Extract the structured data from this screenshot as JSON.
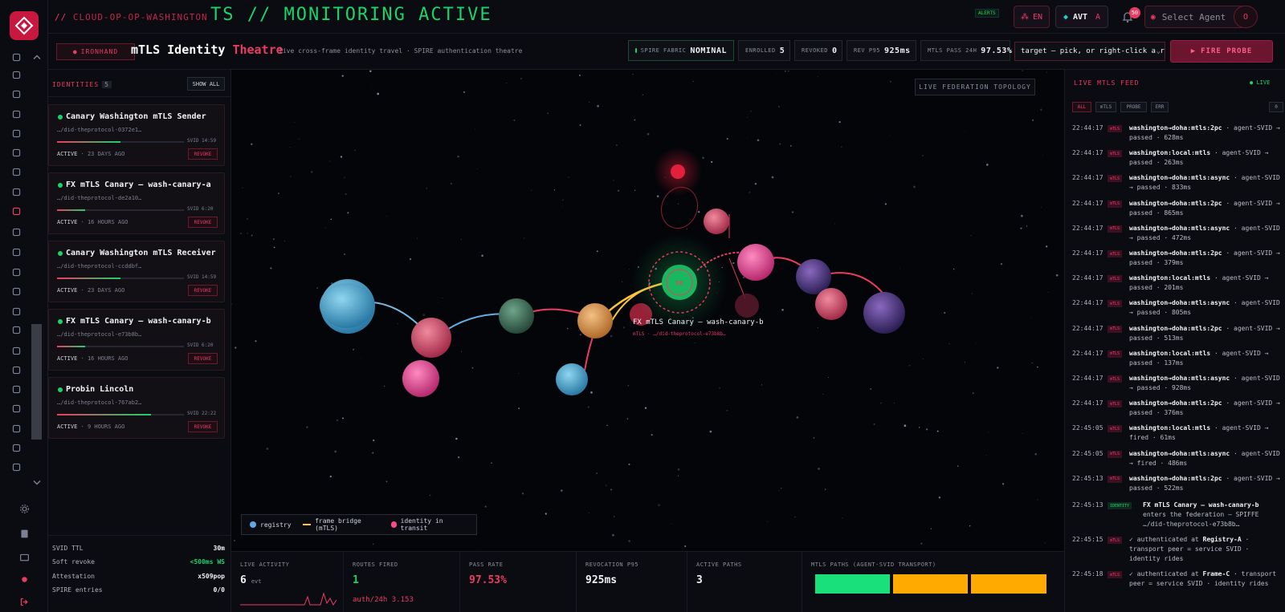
{
  "topbar": {
    "ticker_prefix": "//",
    "ticker_station": "CLOUD-OP-OP-WASHINGTON",
    "ticker_main": "TS  //  MONITORING ACTIVE",
    "alerts_label": "ALERTS",
    "lang_label": "EN",
    "avt_label": "AVT",
    "avt_badge": "A",
    "notif_count": "50",
    "agent_placeholder": "Select Agent",
    "avatar_initial": "O"
  },
  "header": {
    "brand_pill": "IRONHAND",
    "title_a": "mTLS Identity",
    "title_b": "Theatre",
    "subtitle": "live cross-frame identity travel · SPIRE authentication theatre",
    "stats": {
      "fabric_label": "SPIRE FABRIC",
      "fabric_value": "NOMINAL",
      "enrolled_label": "ENROLLED",
      "enrolled_value": "5",
      "revoked_label": "REVOKED",
      "revoked_value": "0",
      "rev_label": "REV P95",
      "rev_value": "925ms",
      "pass_label": "MTLS PASS 24H",
      "pass_value": "97.53%"
    },
    "target_placeholder": "target — pick, or right-click a r",
    "fire_label": "FIRE PROBE"
  },
  "identities": {
    "label": "IDENTITIES",
    "count": "5",
    "show_all": "SHOW ALL",
    "cards": [
      {
        "name": "Canary Washington mTLS Sender",
        "id": "…/did-theprotocol-0372e1…",
        "svid": "SVID 14:59",
        "status": "ACTIVE",
        "age": "23 DAYS AGO",
        "revoke": "REVOKE",
        "progress": 0.5
      },
      {
        "name": "FX mTLS Canary — wash-canary-a",
        "id": "…/did-theprotocol-de2a10…",
        "svid": "SVID 6:20",
        "status": "ACTIVE",
        "age": "16 HOURS AGO",
        "revoke": "REVOKE",
        "progress": 0.22
      },
      {
        "name": "Canary Washington mTLS Receiver",
        "id": "…/did-theprotocol-ccddbf…",
        "svid": "SVID 14:59",
        "status": "ACTIVE",
        "age": "23 DAYS AGO",
        "revoke": "REVOKE",
        "progress": 0.5
      },
      {
        "name": "FX mTLS Canary — wash-canary-b",
        "id": "…/did-theprotocol-e73b8b…",
        "svid": "SVID 6:20",
        "status": "ACTIVE",
        "age": "16 HOURS AGO",
        "revoke": "REVOKE",
        "progress": 0.22
      },
      {
        "name": "Probin Lincoln",
        "id": "…/did-theprotocol-767ab2…",
        "svid": "SVID 22:22",
        "status": "ACTIVE",
        "age": "9 HOURS AGO",
        "revoke": "REVOKE",
        "progress": 0.74
      }
    ],
    "footer": [
      {
        "k": "SVID TTL",
        "v": "30m"
      },
      {
        "k": "Soft revoke",
        "v": "<500ms WS"
      },
      {
        "k": "Attestation",
        "v": "x509pop"
      },
      {
        "k": "SPIRE entries",
        "v": "0/0"
      }
    ]
  },
  "topology": {
    "label": "LIVE FEDERATION TOPOLOGY",
    "hub_label": "FR",
    "focus_name": "FX mTLS Canary — wash-canary-b",
    "focus_id": "mTLS · …/did-theprotocol-e73b8b…",
    "legend": {
      "registry": "registry",
      "bridge": "frame bridge (mTLS)",
      "transit": "identity in transit"
    }
  },
  "kpis": {
    "live_label": "LIVE ACTIVITY",
    "live_value": "6",
    "live_unit": "evt",
    "routes_label": "ROUTES FIRED",
    "routes_value": "1",
    "routes_sub": "auth/24h 3.153",
    "pass_label": "PASS RATE",
    "pass_value": "97.53%",
    "rev_label": "REVOCATION P95",
    "rev_value": "925ms",
    "paths_label": "ACTIVE PATHS",
    "paths_value": "3",
    "transport_label": "MTLS PATHS (AGENT-SVID TRANSPORT)"
  },
  "feed": {
    "title": "LIVE MTLS FEED",
    "live": "LIVE",
    "tabs": [
      "ALL",
      "mTLS",
      "PROBE",
      "ERR"
    ],
    "clear": "0",
    "entries": [
      {
        "t": "22:44:17",
        "tag": "mTLS",
        "b": "washington→doha:mtls:2pc",
        "r": " · agent-SVID → passed · 628ms"
      },
      {
        "t": "22:44:17",
        "tag": "mTLS",
        "b": "washington:local:mtls",
        "r": " · agent-SVID → passed · 263ms"
      },
      {
        "t": "22:44:17",
        "tag": "mTLS",
        "b": "washington→doha:mtls:async",
        "r": " · agent-SVID → passed · 833ms"
      },
      {
        "t": "22:44:17",
        "tag": "mTLS",
        "b": "washington→doha:mtls:2pc",
        "r": " · agent-SVID → passed · 865ms"
      },
      {
        "t": "22:44:17",
        "tag": "mTLS",
        "b": "washington→doha:mtls:async",
        "r": " · agent-SVID → passed · 472ms"
      },
      {
        "t": "22:44:17",
        "tag": "mTLS",
        "b": "washington→doha:mtls:2pc",
        "r": " · agent-SVID → passed · 379ms"
      },
      {
        "t": "22:44:17",
        "tag": "mTLS",
        "b": "washington:local:mtls",
        "r": " · agent-SVID → passed · 201ms"
      },
      {
        "t": "22:44:17",
        "tag": "mTLS",
        "b": "washington→doha:mtls:async",
        "r": " · agent-SVID → passed · 805ms"
      },
      {
        "t": "22:44:17",
        "tag": "mTLS",
        "b": "washington→doha:mtls:2pc",
        "r": " · agent-SVID → passed · 513ms"
      },
      {
        "t": "22:44:17",
        "tag": "mTLS",
        "b": "washington:local:mtls",
        "r": " · agent-SVID → passed · 137ms"
      },
      {
        "t": "22:44:17",
        "tag": "mTLS",
        "b": "washington→doha:mtls:async",
        "r": " · agent-SVID → passed · 928ms"
      },
      {
        "t": "22:44:17",
        "tag": "mTLS",
        "b": "washington→doha:mtls:2pc",
        "r": " · agent-SVID → passed · 376ms"
      },
      {
        "t": "22:45:05",
        "tag": "mTLS",
        "b": "washington:local:mtls",
        "r": " · agent-SVID → fired · 61ms"
      },
      {
        "t": "22:45:05",
        "tag": "mTLS",
        "b": "washington→doha:mtls:async",
        "r": " · agent-SVID → fired · 486ms"
      },
      {
        "t": "22:45:13",
        "tag": "mTLS",
        "b": "washington→doha:mtls:2pc",
        "r": " · agent-SVID → passed · 522ms"
      }
    ],
    "identity_entry": {
      "t": "22:45:13",
      "tag": "IDENTITY",
      "b": "FX mTLS Canary — wash-canary-b",
      "r": " enters the federation — SPIFFE …/did-theprotocol-e73b8b…"
    },
    "auth_entries": [
      {
        "t": "22:45:15",
        "tag": "mTLS",
        "a": "✓ authenticated at ",
        "b": "Registry-A",
        "r": " · transport peer = service SVID · identity rides"
      },
      {
        "t": "22:45:18",
        "tag": "mTLS",
        "a": "✓ authenticated at ",
        "b": "Frame-C",
        "r": " · transport peer = service SVID · identity rides"
      }
    ]
  },
  "colors": {
    "accent": "#ec3b62",
    "ok": "#19d36b",
    "warn": "#ffaa00"
  }
}
